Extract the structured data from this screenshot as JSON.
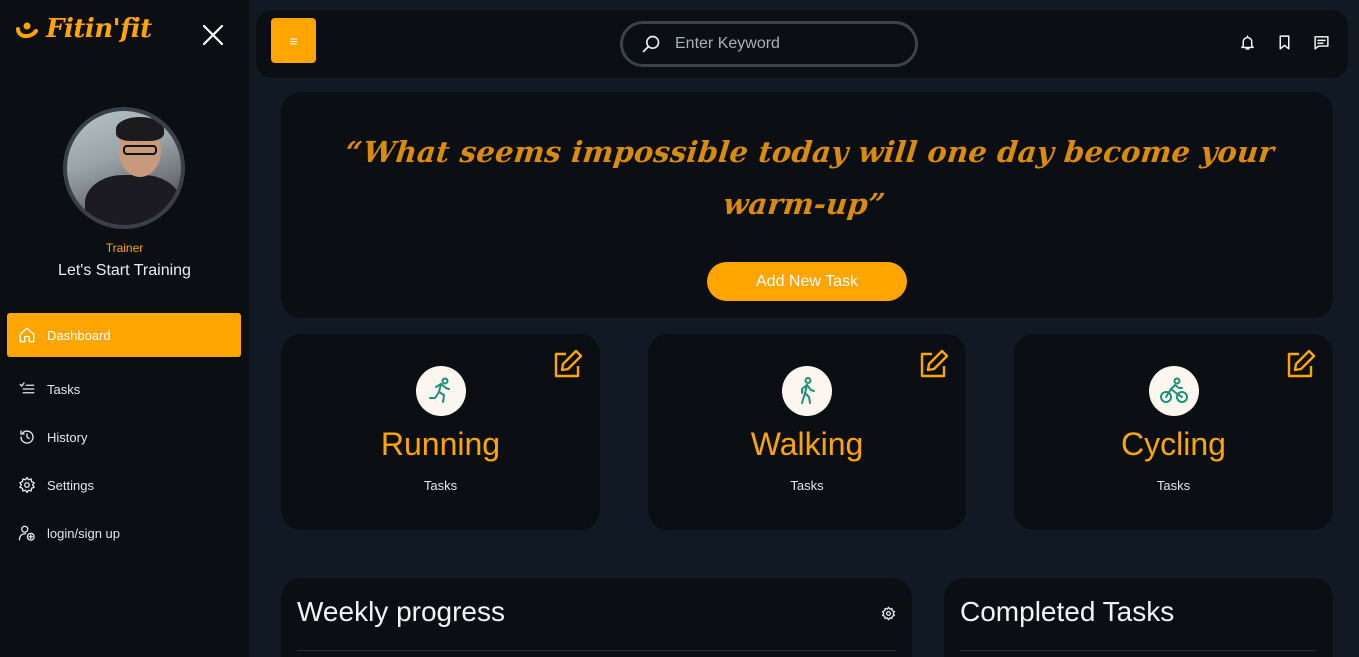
{
  "colors": {
    "accent": "#ffa500",
    "sidebar_bg": "#0b0f14",
    "page_bg": "#111a24",
    "icon_green": "#1e8f78"
  },
  "brand": {
    "name": "Fitin'fit"
  },
  "profile": {
    "role": "Trainer",
    "tagline": "Let's Start Training"
  },
  "sidebar": {
    "items": [
      {
        "label": "Dashboard",
        "icon": "home-icon",
        "active": true
      },
      {
        "label": "Tasks",
        "icon": "list-check-icon"
      },
      {
        "label": "History",
        "icon": "history-icon"
      },
      {
        "label": "Settings",
        "icon": "gear-icon"
      },
      {
        "label": "login/sign up",
        "icon": "user-add-icon"
      }
    ]
  },
  "header": {
    "menu_icon": "≡",
    "search_placeholder": "Enter Keyword",
    "icons": [
      "bell-icon",
      "bookmark-icon",
      "message-icon"
    ]
  },
  "hero": {
    "quote": "“What seems impossible today will one day become your warm-up”",
    "button_label": "Add New Task"
  },
  "activities": [
    {
      "title": "Running",
      "subtitle": "Tasks",
      "icon": "running-icon"
    },
    {
      "title": "Walking",
      "subtitle": "Tasks",
      "icon": "walking-icon"
    },
    {
      "title": "Cycling",
      "subtitle": "Tasks",
      "icon": "cycling-icon"
    }
  ],
  "panels": {
    "weekly": {
      "title": "Weekly progress"
    },
    "completed": {
      "title": "Completed Tasks"
    }
  }
}
